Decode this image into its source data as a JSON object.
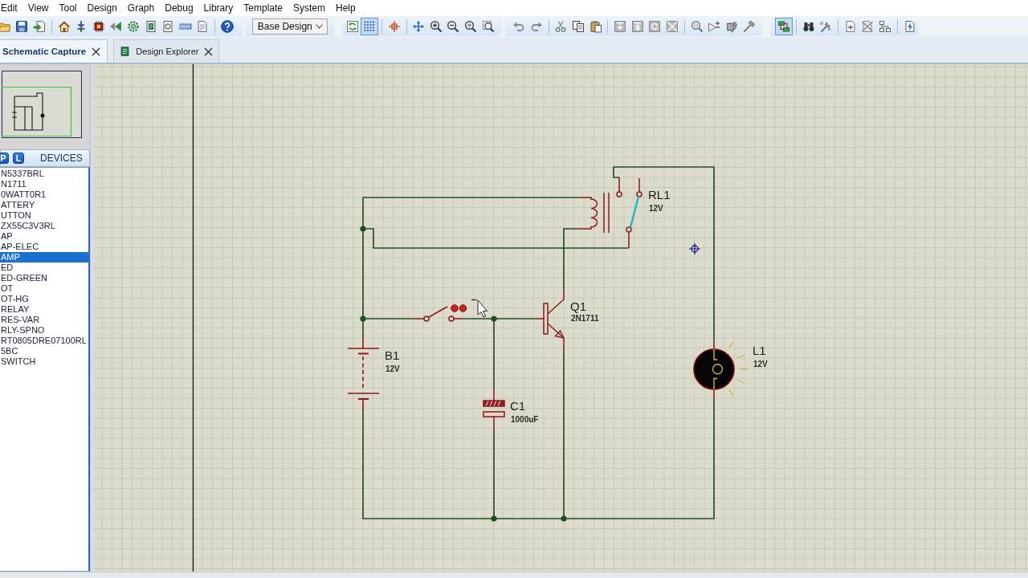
{
  "menu_bar": {
    "items": [
      "Edit",
      "View",
      "Tool",
      "Design",
      "Graph",
      "Debug",
      "Library",
      "Template",
      "System",
      "Help"
    ]
  },
  "toolbar": {
    "dropdown": {
      "value": "Base Design"
    },
    "toggle_buttons": [
      {
        "on": true
      },
      {
        "on": true
      }
    ]
  },
  "tabs": [
    {
      "label": "Schematic Capture",
      "selected": true,
      "kind": "schematic"
    },
    {
      "label": "Design Explorer",
      "selected": false,
      "kind": "explorer"
    }
  ],
  "device_panel": {
    "mode_buttons": [
      "P",
      "L"
    ],
    "title": "DEVICES",
    "items": [
      {
        "name": "N5337BRL",
        "selected": false
      },
      {
        "name": "N1711",
        "selected": false
      },
      {
        "name": "0WATT0R1",
        "selected": false
      },
      {
        "name": "ATTERY",
        "selected": false
      },
      {
        "name": "UTTON",
        "selected": false
      },
      {
        "name": "ZX55C3V3RL",
        "selected": false
      },
      {
        "name": "AP",
        "selected": false
      },
      {
        "name": "AP-ELEC",
        "selected": false
      },
      {
        "name": "AMP",
        "selected": true
      },
      {
        "name": "ED",
        "selected": false
      },
      {
        "name": "ED-GREEN",
        "selected": false
      },
      {
        "name": "OT",
        "selected": false
      },
      {
        "name": "OT-HG",
        "selected": false
      },
      {
        "name": "RELAY",
        "selected": false
      },
      {
        "name": "RES-VAR",
        "selected": false
      },
      {
        "name": "RLY-SPNO",
        "selected": false
      },
      {
        "name": "RT0805DRE07100RL",
        "selected": false
      },
      {
        "name": "5BC",
        "selected": false
      },
      {
        "name": "SWITCH",
        "selected": false
      }
    ]
  },
  "schematic": {
    "components": [
      {
        "kind": "battery",
        "ref": "B1",
        "value": "12V"
      },
      {
        "kind": "push_button",
        "closed": false
      },
      {
        "kind": "npn_transistor",
        "ref": "Q1",
        "value": "2N1711"
      },
      {
        "kind": "capacitor",
        "ref": "C1",
        "value": "1000uF"
      },
      {
        "kind": "relay",
        "ref": "RL1",
        "value": "12V",
        "energized": true
      },
      {
        "kind": "lamp",
        "ref": "L1",
        "value": "12V",
        "lit": true
      }
    ]
  }
}
